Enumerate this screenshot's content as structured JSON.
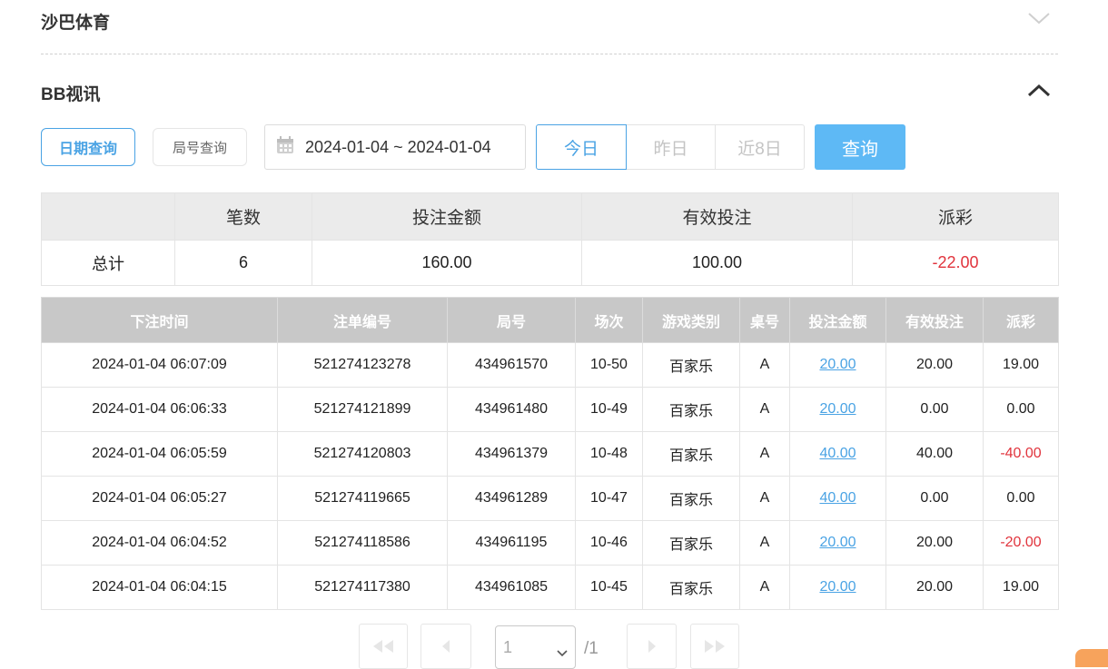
{
  "sections": {
    "sports": {
      "title": "沙巴体育",
      "expanded": false
    },
    "bbvideo": {
      "title": "BB视讯",
      "expanded": true
    }
  },
  "filters": {
    "date_query_label": "日期查询",
    "round_query_label": "局号查询",
    "date_range": "2024-01-04 ~ 2024-01-04",
    "quick_ranges": [
      "今日",
      "昨日",
      "近8日"
    ],
    "active_quick_range": "今日",
    "query_label": "查询"
  },
  "summary": {
    "headers": [
      "",
      "笔数",
      "投注金额",
      "有效投注",
      "派彩"
    ],
    "row": {
      "label": "总计",
      "count": "6",
      "bet": "160.00",
      "valid": "100.00",
      "payout": "-22.00"
    }
  },
  "details": {
    "headers": [
      "下注时间",
      "注单编号",
      "局号",
      "场次",
      "游戏类别",
      "桌号",
      "投注金额",
      "有效投注",
      "派彩"
    ],
    "rows": [
      [
        "2024-01-04 06:07:09",
        "521274123278",
        "434961570",
        "10-50",
        "百家乐",
        "A",
        "20.00",
        "20.00",
        "19.00"
      ],
      [
        "2024-01-04 06:06:33",
        "521274121899",
        "434961480",
        "10-49",
        "百家乐",
        "A",
        "20.00",
        "0.00",
        "0.00"
      ],
      [
        "2024-01-04 06:05:59",
        "521274120803",
        "434961379",
        "10-48",
        "百家乐",
        "A",
        "40.00",
        "40.00",
        "-40.00"
      ],
      [
        "2024-01-04 06:05:27",
        "521274119665",
        "434961289",
        "10-47",
        "百家乐",
        "A",
        "40.00",
        "0.00",
        "0.00"
      ],
      [
        "2024-01-04 06:04:52",
        "521274118586",
        "434961195",
        "10-46",
        "百家乐",
        "A",
        "20.00",
        "20.00",
        "-20.00"
      ],
      [
        "2024-01-04 06:04:15",
        "521274117380",
        "434961085",
        "10-45",
        "百家乐",
        "A",
        "20.00",
        "20.00",
        "19.00"
      ]
    ]
  },
  "pagination": {
    "current_page": "1",
    "total": "/1"
  },
  "colors": {
    "accent": "#4aa3e4",
    "primary_button": "#5eb9f5",
    "negative": "#e1343d",
    "table_header": "#c8c8c8"
  }
}
